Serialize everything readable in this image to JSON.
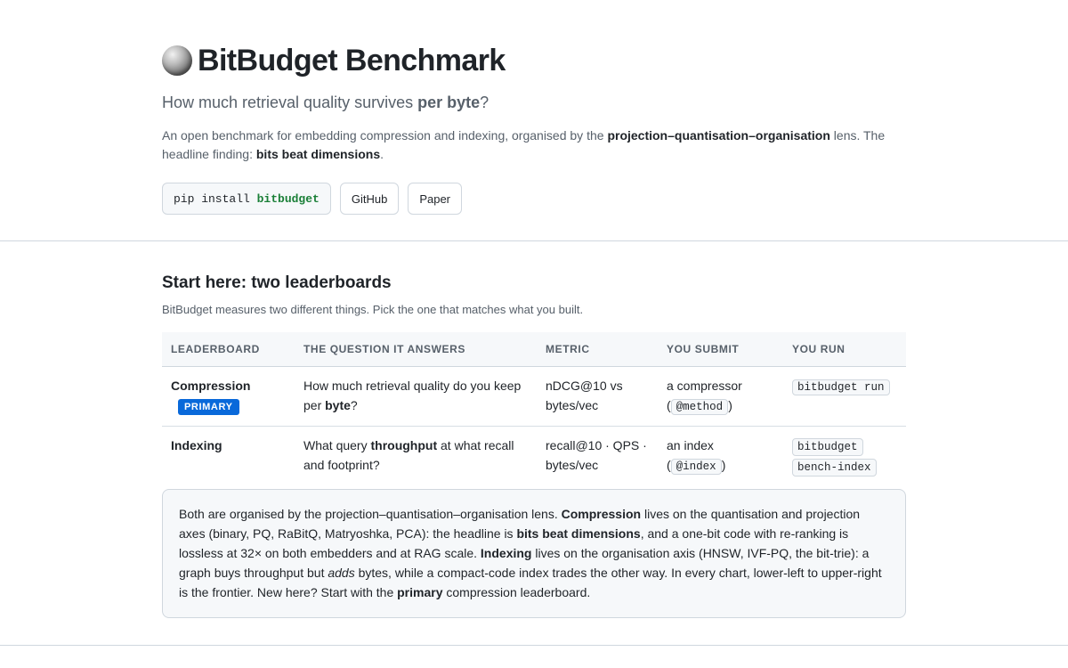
{
  "header": {
    "title": "BitBudget Benchmark",
    "logo_icon": "globe-icon",
    "tagline_pre": "How much retrieval quality survives ",
    "tagline_bold": "per byte",
    "tagline_post": "?",
    "desc_1": "An open benchmark for embedding compression and indexing, organised by the ",
    "desc_b1": "projection–quantisation–organisation",
    "desc_2": " lens. The headline finding: ",
    "desc_b2": "bits beat dimensions",
    "desc_3": "."
  },
  "actions": {
    "install_cmd": "pip install ",
    "install_pkg": "bitbudget",
    "github_label": "GitHub",
    "paper_label": "Paper"
  },
  "section": {
    "title": "Start here: two leaderboards",
    "subtitle": "BitBudget measures two different things. Pick the one that matches what you built."
  },
  "table": {
    "headers": [
      "LEADERBOARD",
      "THE QUESTION IT ANSWERS",
      "METRIC",
      "YOU SUBMIT",
      "YOU RUN"
    ],
    "rows": [
      {
        "name": "Compression",
        "badge": "PRIMARY",
        "q_pre": "How much retrieval quality do you keep per ",
        "q_bold": "byte",
        "q_post": "?",
        "metric": "nDCG@10 vs bytes/vec",
        "submit_pre": "a compressor (",
        "submit_code": "@method",
        "submit_post": ")",
        "run": "bitbudget run"
      },
      {
        "name": "Indexing",
        "q_pre": "What query ",
        "q_bold": "throughput",
        "q_post": " at what recall and footprint?",
        "metric": "recall@10 · QPS · bytes/vec",
        "submit_pre": "an index (",
        "submit_code": "@index",
        "submit_post": ")",
        "run_1": "bitbudget",
        "run_2": "bench-index"
      }
    ]
  },
  "note": {
    "t1": "Both are organised by the projection–quantisation–organisation lens. ",
    "b1": "Compression",
    "t2": " lives on the quantisation and projection axes (binary, PQ, RaBitQ, Matryoshka, PCA): the headline is ",
    "b2": "bits beat dimensions",
    "t3": ", and a one-bit code with re-ranking is lossless at 32× on both embedders and at RAG scale. ",
    "b3": "Indexing",
    "t4": " lives on the organisation axis (HNSW, IVF-PQ, the bit-trie): a graph buys throughput but ",
    "i1": "adds",
    "t5": " bytes, while a compact-code index trades the other way. In every chart, lower-left to upper-right is the frontier. New here? Start with the ",
    "b4": "primary",
    "t6": " compression leaderboard."
  }
}
